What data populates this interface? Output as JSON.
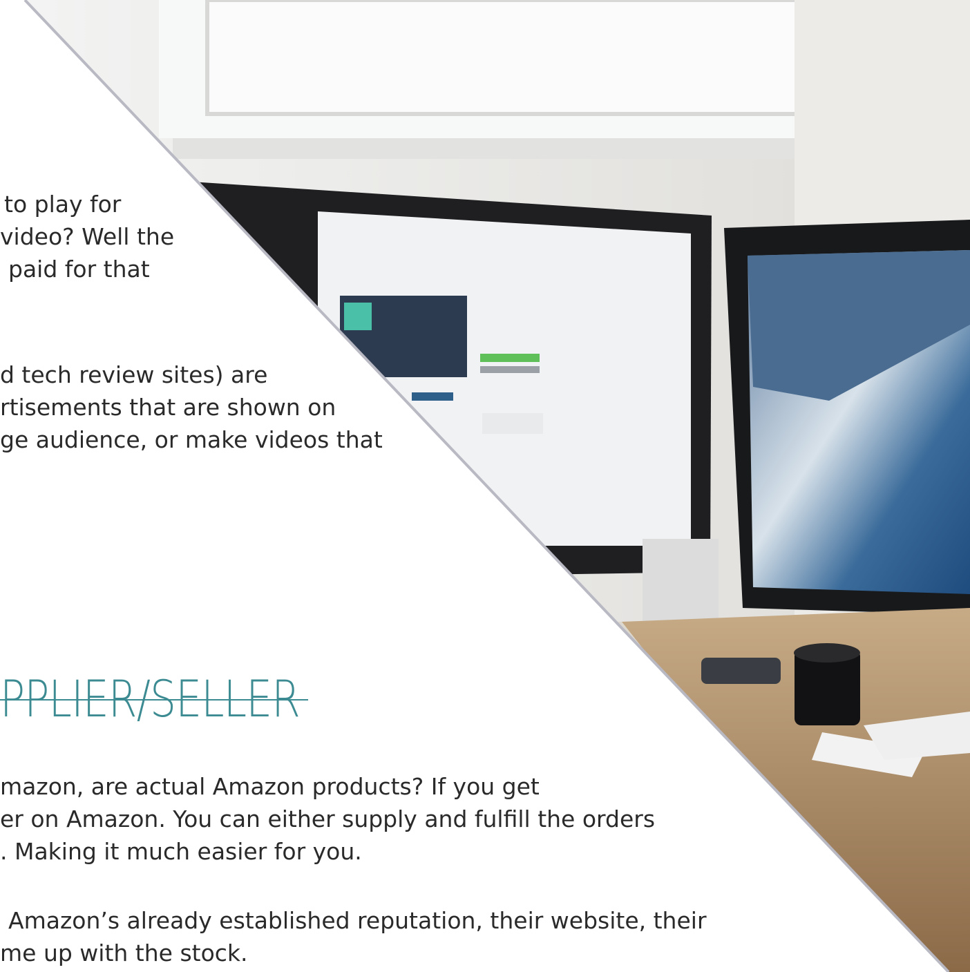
{
  "article": {
    "para1": [
      "to play for",
      "video? Well the",
      "paid for that"
    ],
    "para2": [
      "d tech review sites) are",
      "rtisements that are shown on",
      "ge audience, or make videos that"
    ],
    "heading": "PPLIER/SELLER",
    "para3": [
      "mazon, are actual Amazon products? If you get",
      "er on Amazon. You can either supply and fulfill the orders",
      ". Making it much easier for you."
    ],
    "para4": [
      "Amazon’s already established reputation, their website, their",
      "me up with the stock."
    ]
  },
  "photo": {
    "description_icon": "desk-monitors-photo",
    "divider_color": "#b9b9c4",
    "accent_color": "#3c8b92"
  }
}
